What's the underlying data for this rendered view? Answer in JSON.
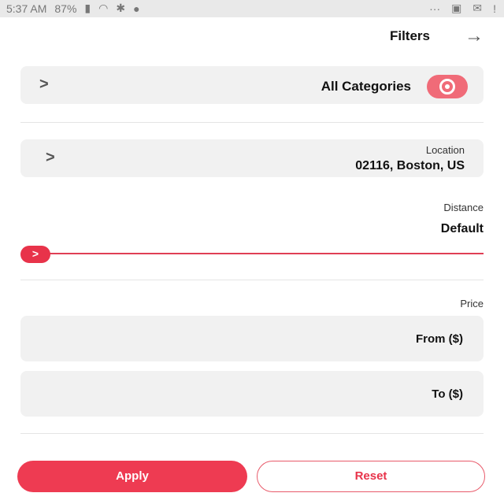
{
  "status_bar": {
    "time": "5:37 AM",
    "battery": "87%",
    "left_icons": [
      "signal-icon",
      "wifi-icon",
      "bluetooth-icon",
      "location-icon"
    ],
    "right_icons": [
      "more-icon",
      "image-icon",
      "mail-icon",
      "alert-icon"
    ]
  },
  "header": {
    "title": "Filters",
    "back_icon": "arrow-icon"
  },
  "category": {
    "label": "All Categories",
    "icon": "eye-icon",
    "accent": "#f06b78"
  },
  "location": {
    "label": "Location",
    "value": "02116, Boston, US"
  },
  "distance": {
    "label": "Distance",
    "value": "Default",
    "slider_level": 0
  },
  "price": {
    "label": "Price",
    "from_placeholder": "From ($)",
    "to_placeholder": "To ($)"
  },
  "actions": {
    "apply_label": "Apply",
    "reset_label": "Reset",
    "accent": "#ee3b52"
  }
}
